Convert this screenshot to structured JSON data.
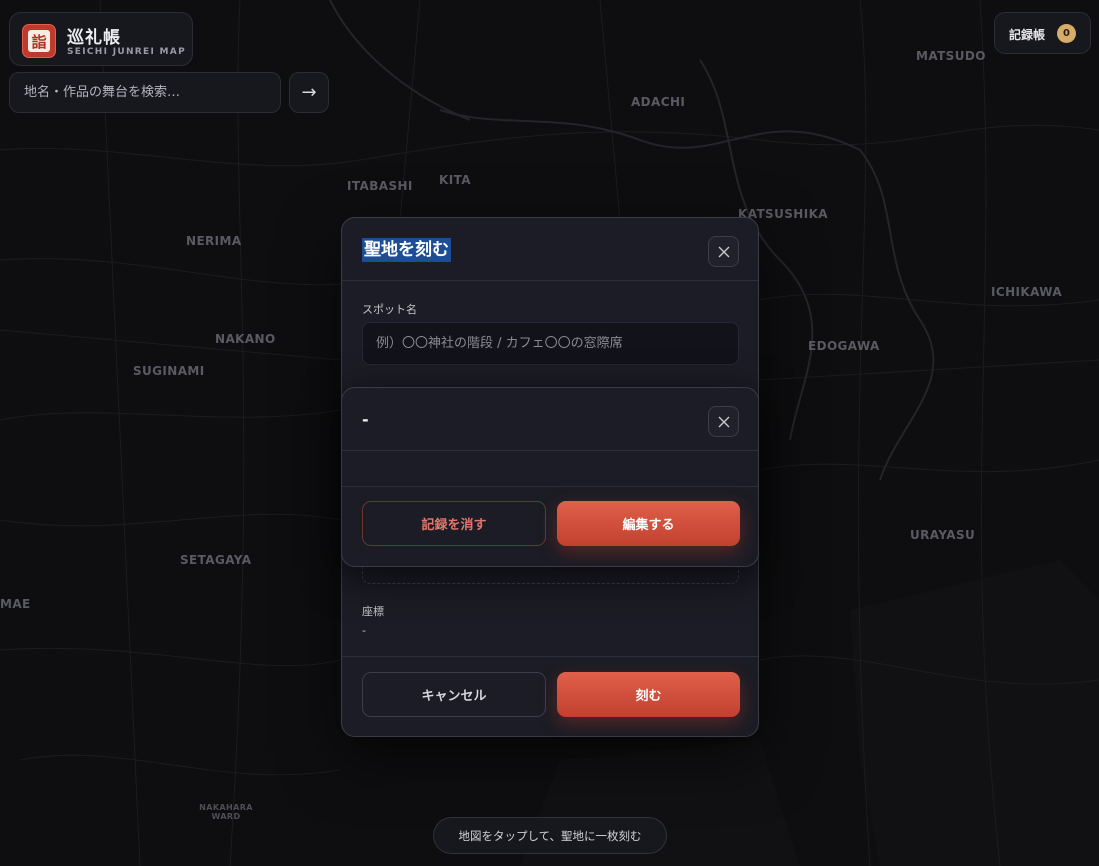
{
  "app": {
    "logo_glyph": "詣",
    "title": "巡礼帳",
    "subtitle": "SEICHI JUNREI MAP"
  },
  "search": {
    "placeholder": "地名・作品の舞台を検索…",
    "go_label": "→"
  },
  "record_book": {
    "label": "記録帳",
    "count": "0"
  },
  "map": {
    "labels": {
      "matsudo": "MATSUDO",
      "adachi": "ADACHI",
      "itabashi": "ITABASHI",
      "kita": "KITA",
      "katsushika": "KATSUSHIKA",
      "nerima": "NERIMA",
      "ichikawa": "ICHIKAWA",
      "nakano": "NAKANO",
      "edogawa": "EDOGAWA",
      "suginami": "SUGINAMI",
      "urayasu": "URAYASU",
      "setagaya": "SETAGAYA",
      "mae": "MAE",
      "nakahara": "NAKAHARA WARD"
    }
  },
  "modal": {
    "title": "聖地を刻む",
    "spot_label": "スポット名",
    "spot_placeholder": "例）〇〇神社の階段 / カフェ〇〇の窓際席",
    "coord_label": "座標",
    "coord_value": "-",
    "cancel_label": "キャンセル",
    "submit_label": "刻む"
  },
  "detail": {
    "title": "-",
    "delete_label": "記録を消す",
    "edit_label": "編集する"
  },
  "hint": "地図をタップして、聖地に一枚刻む",
  "colors": {
    "accent": "#d4513e",
    "badge": "#d7ab6a",
    "background": "#0c0c0e",
    "panel": "#1b1c25"
  }
}
